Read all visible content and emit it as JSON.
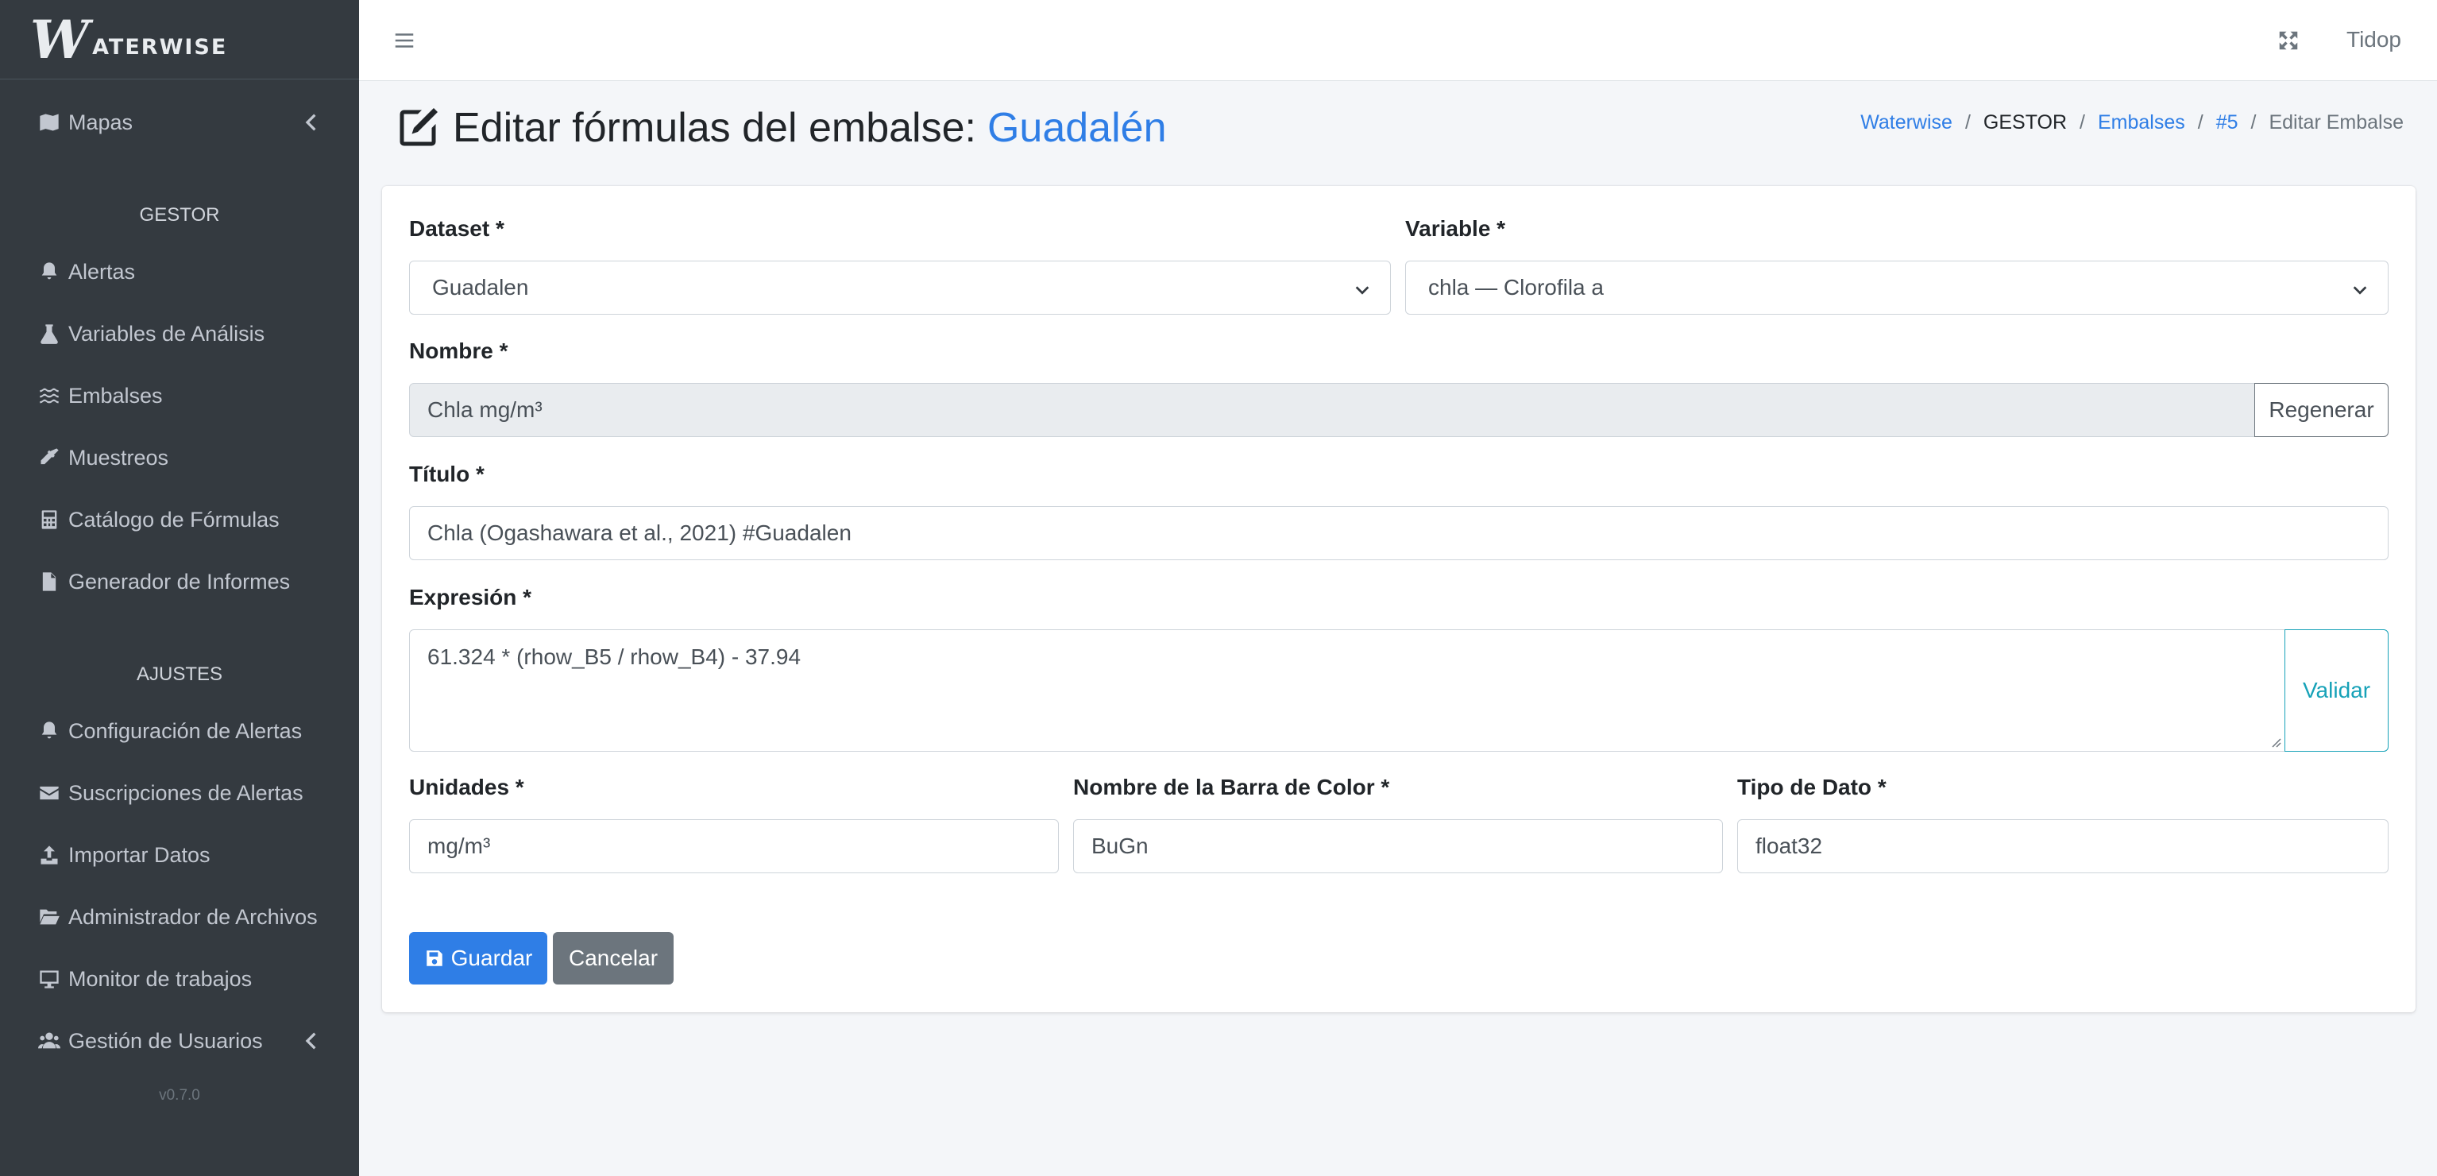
{
  "brand": {
    "logo_initial": "W",
    "logo_rest": "ATERWISE"
  },
  "sidebar": {
    "top_items": [
      {
        "label": "Mapas",
        "icon": "map-icon",
        "has_chevron": true
      }
    ],
    "sections": [
      {
        "header": "GESTOR",
        "items": [
          {
            "label": "Alertas",
            "icon": "bell-icon"
          },
          {
            "label": "Variables de Análisis",
            "icon": "flask-icon"
          },
          {
            "label": "Embalses",
            "icon": "water-icon"
          },
          {
            "label": "Muestreos",
            "icon": "eyedropper-icon"
          },
          {
            "label": "Catálogo de Fórmulas",
            "icon": "calculator-icon"
          },
          {
            "label": "Generador de Informes",
            "icon": "file-text-icon"
          }
        ]
      },
      {
        "header": "AJUSTES",
        "items": [
          {
            "label": "Configuración de Alertas",
            "icon": "bell-icon"
          },
          {
            "label": "Suscripciones de Alertas",
            "icon": "envelope-icon"
          },
          {
            "label": "Importar Datos",
            "icon": "upload-icon"
          },
          {
            "label": "Administrador de Archivos",
            "icon": "folder-open-icon"
          },
          {
            "label": "Monitor de trabajos",
            "icon": "desktop-icon"
          },
          {
            "label": "Gestión de Usuarios",
            "icon": "users-icon",
            "has_chevron": true
          }
        ]
      }
    ],
    "version": "v0.7.0"
  },
  "topbar": {
    "user": "Tidop"
  },
  "header": {
    "title_prefix": "Editar fórmulas del embalse:",
    "title_highlight": "Guadalén",
    "breadcrumb": {
      "waterwise": "Waterwise",
      "gestor": "GESTOR",
      "embalses": "Embalses",
      "id": "#5",
      "current": "Editar Embalse"
    }
  },
  "form": {
    "dataset": {
      "label": "Dataset *",
      "value": "Guadalen"
    },
    "variable": {
      "label": "Variable *",
      "value": "chla — Clorofila a"
    },
    "nombre": {
      "label": "Nombre *",
      "value": "Chla mg/m³",
      "button": "Regenerar"
    },
    "titulo": {
      "label": "Título *",
      "value": "Chla (Ogashawara et al., 2021) #Guadalen"
    },
    "expresion": {
      "label": "Expresión *",
      "value": "61.324 * (rhow_B5 / rhow_B4) - 37.94",
      "button": "Validar"
    },
    "unidades": {
      "label": "Unidades *",
      "value": "mg/m³"
    },
    "barra_color": {
      "label": "Nombre de la Barra de Color *",
      "value": "BuGn"
    },
    "tipo_dato": {
      "label": "Tipo de Dato *",
      "value": "float32"
    },
    "save_label": "Guardar",
    "cancel_label": "Cancelar"
  },
  "colors": {
    "primary": "#2f7ee6",
    "sidebar_bg": "#343a40",
    "secondary": "#6c757d",
    "info": "#17a2b8"
  }
}
